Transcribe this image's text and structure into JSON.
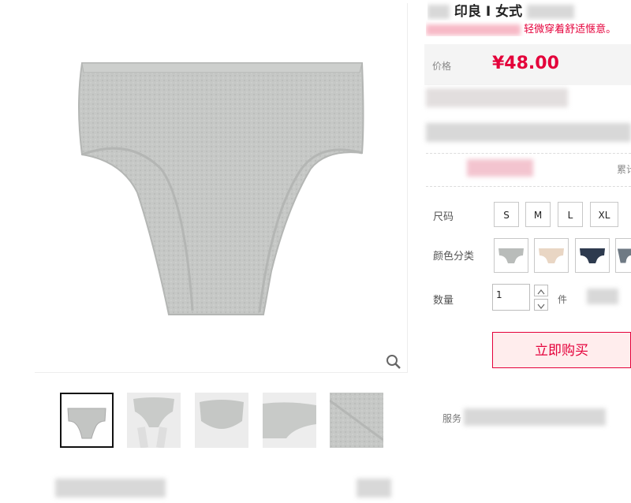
{
  "product": {
    "title": "印良 I 女式",
    "subtitle": "轻微穿着舒适惬意。"
  },
  "price": {
    "label": "价格",
    "value": "¥48.00"
  },
  "sales": {
    "cumulative_label": "累计"
  },
  "options": {
    "size_label": "尺码",
    "sizes": [
      "S",
      "M",
      "L",
      "XL"
    ],
    "color_label": "颜色分类",
    "colors": [
      "#b9bcba",
      "#e9d6c4",
      "#2d3a4e",
      "#6f7a84"
    ],
    "quantity_label": "数量",
    "quantity_value": "1",
    "unit": "件"
  },
  "actions": {
    "buy_now": "立即购买"
  },
  "service": {
    "label": "服务"
  },
  "icons": {
    "zoom": "magnifier-icon",
    "qty_up": "chevron-up-icon",
    "qty_down": "chevron-down-icon"
  }
}
